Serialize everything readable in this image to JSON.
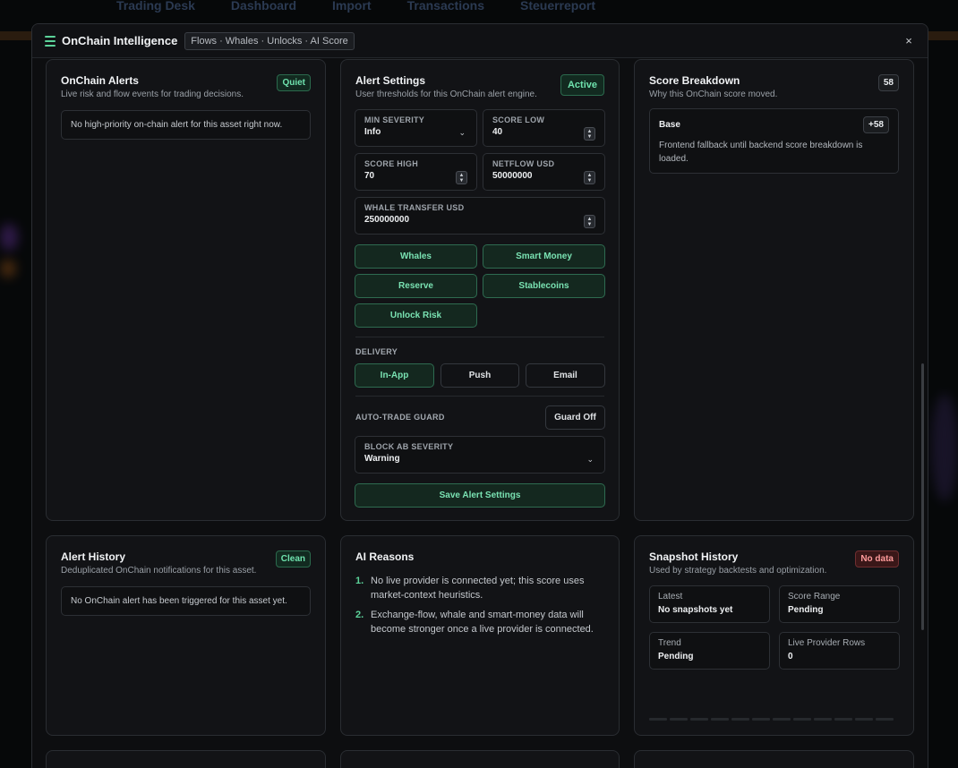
{
  "background": {
    "nav_items": [
      "Trading Desk",
      "Dashboard",
      "Import",
      "Transactions",
      "Steuerreport"
    ]
  },
  "modal": {
    "title": "OnChain Intelligence",
    "chip": "Flows · Whales · Unlocks · AI Score",
    "close_label": "×"
  },
  "alerts": {
    "title": "OnChain Alerts",
    "subtitle": "Live risk and flow events for trading decisions.",
    "badge": "Quiet",
    "empty": "No high-priority on-chain alert for this asset right now."
  },
  "settings": {
    "title": "Alert Settings",
    "subtitle": "User thresholds for this OnChain alert engine.",
    "badge": "Active",
    "min_severity": {
      "label": "MIN SEVERITY",
      "value": "Info"
    },
    "score_low": {
      "label": "SCORE LOW",
      "value": "40"
    },
    "score_high": {
      "label": "SCORE HIGH",
      "value": "70"
    },
    "netflow_usd": {
      "label": "NETFLOW USD",
      "value": "50000000"
    },
    "whale_transfer_usd": {
      "label": "WHALE TRANSFER USD",
      "value": "250000000"
    },
    "categories": [
      "Whales",
      "Smart Money",
      "Reserve",
      "Stablecoins",
      "Unlock Risk"
    ],
    "delivery_label": "DELIVERY",
    "delivery": [
      {
        "label": "In-App",
        "active": true
      },
      {
        "label": "Push",
        "active": false
      },
      {
        "label": "Email",
        "active": false
      }
    ],
    "guard_label": "AUTO-TRADE GUARD",
    "guard_button": "Guard Off",
    "block_severity": {
      "label": "BLOCK AB SEVERITY",
      "value": "Warning"
    },
    "save_button": "Save Alert Settings"
  },
  "breakdown": {
    "title": "Score Breakdown",
    "subtitle": "Why this OnChain score moved.",
    "badge": "58",
    "item": {
      "name": "Base",
      "delta": "+58",
      "description": "Frontend fallback until backend score breakdown is loaded."
    }
  },
  "history": {
    "title": "Alert History",
    "subtitle": "Deduplicated OnChain notifications for this asset.",
    "badge": "Clean",
    "empty": "No OnChain alert has been triggered for this asset yet."
  },
  "reasons": {
    "title": "AI Reasons",
    "items": [
      {
        "num": "1.",
        "text": "No live provider is connected yet; this score uses market-context heuristics."
      },
      {
        "num": "2.",
        "text": "Exchange-flow, whale and smart-money data will become stronger once a live provider is connected."
      }
    ]
  },
  "snapshots": {
    "title": "Snapshot History",
    "subtitle": "Used by strategy backtests and optimization.",
    "badge": "No data",
    "stats": [
      {
        "label": "Latest",
        "value": "No snapshots yet"
      },
      {
        "label": "Score Range",
        "value": "Pending"
      },
      {
        "label": "Trend",
        "value": "Pending"
      },
      {
        "label": "Live Provider Rows",
        "value": "0"
      }
    ]
  },
  "colors": {
    "accent": "#5cd39a",
    "panel": "#121316",
    "alert_red": "#ff9b9b"
  }
}
